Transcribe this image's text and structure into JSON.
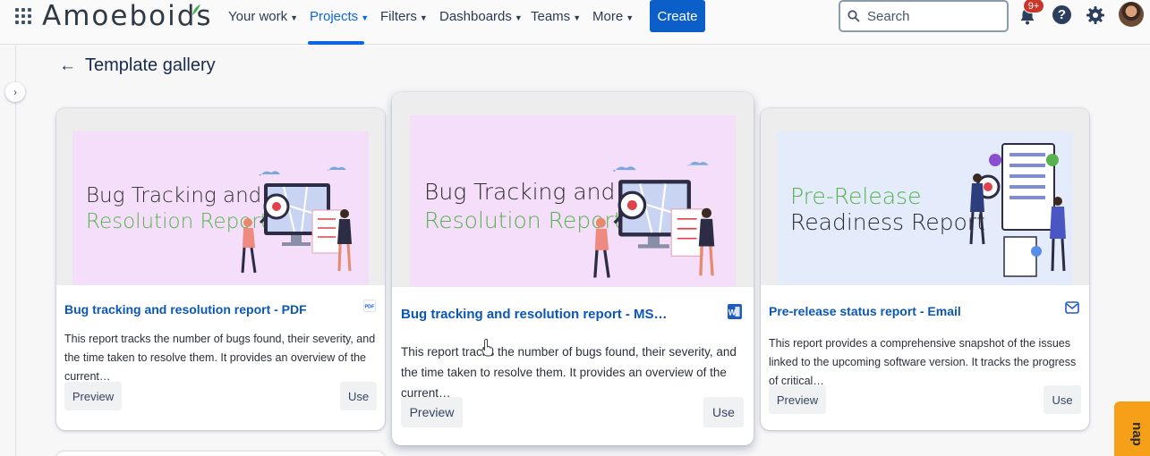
{
  "header": {
    "logo": "Amoeboids",
    "nav": [
      {
        "label": "Your work"
      },
      {
        "label": "Projects"
      },
      {
        "label": "Filters"
      },
      {
        "label": "Dashboards"
      },
      {
        "label": "Teams"
      },
      {
        "label": "More"
      }
    ],
    "create_label": "Create",
    "search_placeholder": "Search",
    "notifications_badge": "9+"
  },
  "page": {
    "title": "Template gallery"
  },
  "cards": [
    {
      "banner_line1": "Bug Tracking and",
      "banner_line2": "Resolution Report",
      "title": "Bug tracking and resolution report - PDF",
      "format_icon": "pdf-icon",
      "format_label": "PDF",
      "description": "This report tracks the number of bugs found, their severity, and the time taken to resolve them. It provides an overview of the current…",
      "preview_label": "Preview",
      "use_label": "Use"
    },
    {
      "banner_line1": "Bug Tracking and",
      "banner_line2": "Resolution Report",
      "title": "Bug tracking and resolution report - MS…",
      "format_icon": "ms-word-icon",
      "format_label": "",
      "description": "This report tracks the number of bugs found, their severity, and the time taken to resolve them. It provides an overview of the current…",
      "preview_label": "Preview",
      "use_label": "Use"
    },
    {
      "banner_line1": "Pre-Release",
      "banner_line2": "Readiness Report",
      "title": "Pre-release status report - Email",
      "format_icon": "email-icon",
      "format_label": "",
      "description": "This report provides a comprehensive snapshot of the issues linked to the upcoming software version. It tracks the progress of critical…",
      "preview_label": "Preview",
      "use_label": "Use"
    }
  ],
  "side_tab_label": "nap",
  "colors": {
    "primary": "#0c66e4",
    "banner_pink": "#f5def9",
    "banner_blue": "#e4ebfa",
    "banner_green": "#58b24f",
    "tab_orange": "#f6a01a"
  }
}
